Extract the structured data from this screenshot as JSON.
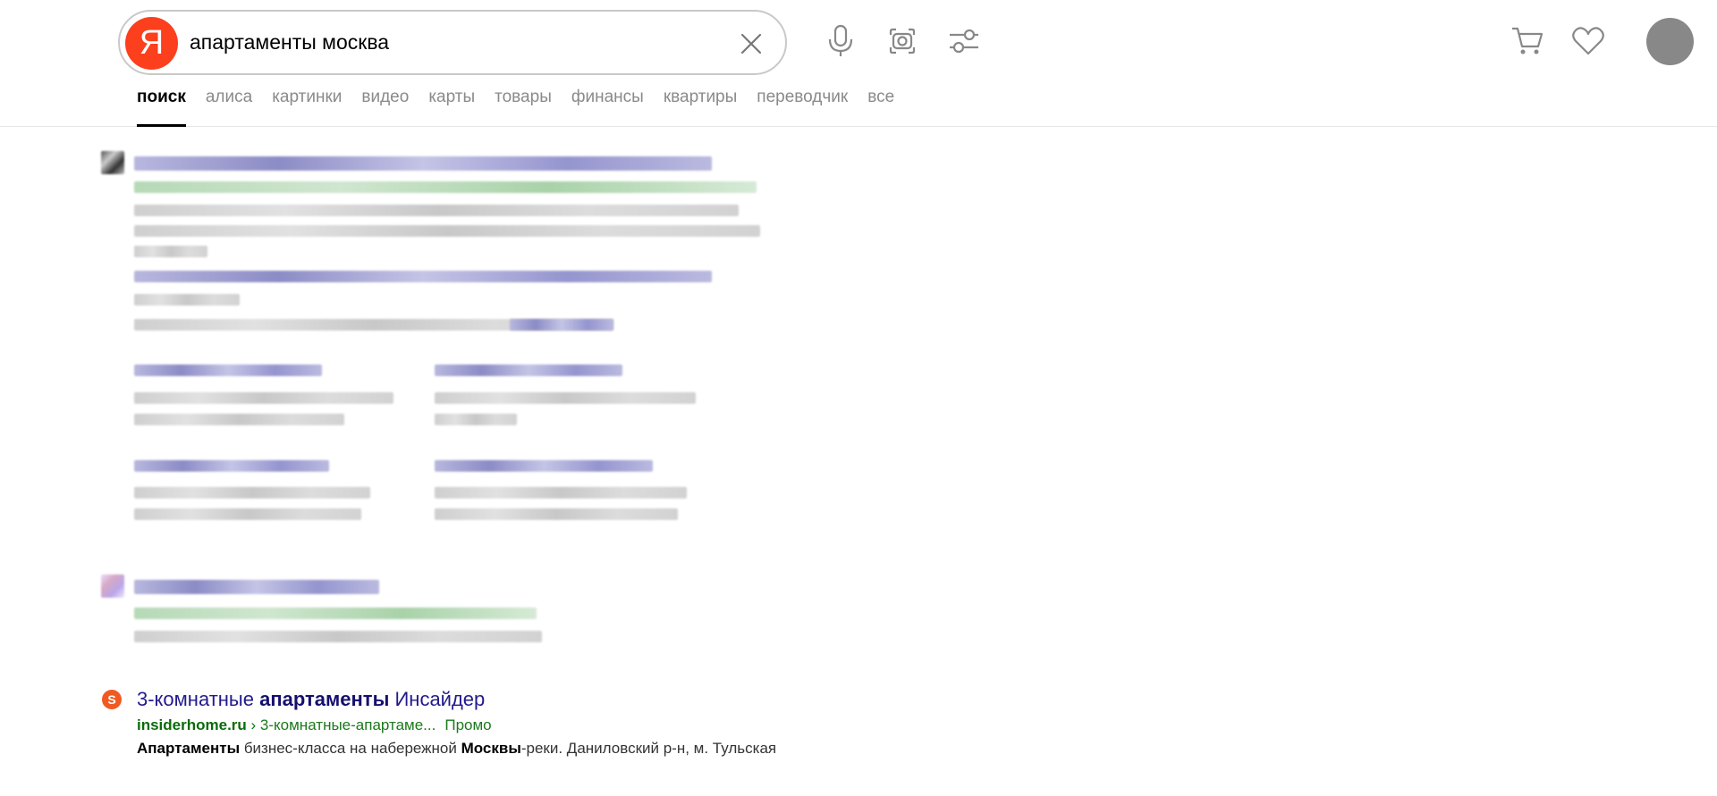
{
  "search": {
    "logo_letter": "Я",
    "query": "апартаменты москва"
  },
  "tabs": [
    {
      "label": "поиск",
      "active": true
    },
    {
      "label": "алиса"
    },
    {
      "label": "картинки"
    },
    {
      "label": "видео"
    },
    {
      "label": "карты"
    },
    {
      "label": "товары"
    },
    {
      "label": "финансы"
    },
    {
      "label": "квартиры"
    },
    {
      "label": "переводчик"
    },
    {
      "label": "все"
    }
  ],
  "icons": {
    "clear": "close-icon",
    "voice": "microphone-icon",
    "camera": "camera-search-icon",
    "filters": "filters-icon",
    "cart": "cart-icon",
    "favorites": "heart-icon",
    "avatar": "avatar"
  },
  "result": {
    "favicon_letter": "S",
    "title_pre": "3-комнатные ",
    "title_bold": "апартаменты",
    "title_post": " Инсайдер",
    "domain": "insiderhome.ru",
    "separator": " › ",
    "path": "3-комнатные-апартаме...",
    "promo": "Промо",
    "snippet_b1": "Апартаменты",
    "snippet_t1": " бизнес-класса на набережной ",
    "snippet_b2": "Москвы",
    "snippet_t2": "-реки. Даниловский р-н, м. Тульская"
  },
  "colors": {
    "brand_red": "#fc3f1d",
    "link": "#221a8c",
    "url_green": "#0b6b0b"
  }
}
